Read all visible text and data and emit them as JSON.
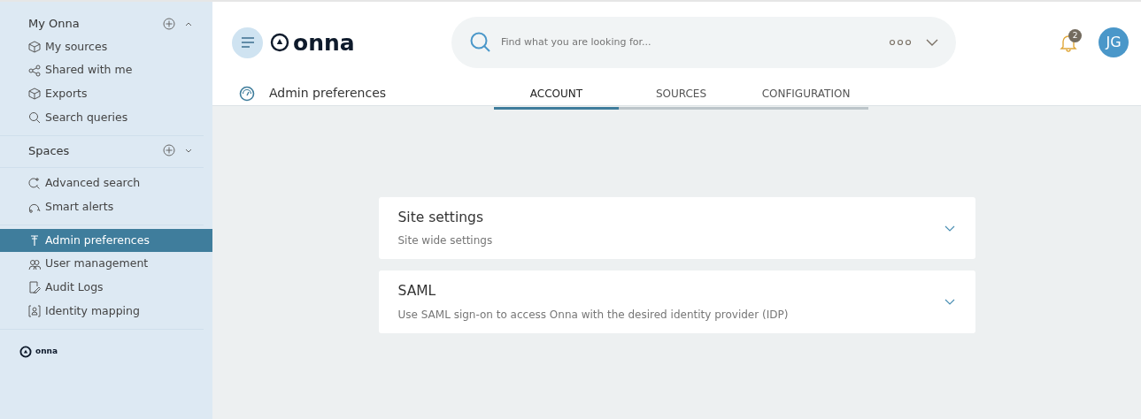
{
  "sidebar": {
    "sections": [
      {
        "title": "My Onna",
        "expanded": true,
        "items": [
          {
            "label": "My sources",
            "selected": false
          },
          {
            "label": "Shared with me",
            "selected": false
          },
          {
            "label": "Exports",
            "selected": false
          },
          {
            "label": "Search queries",
            "selected": false
          }
        ]
      },
      {
        "title": "Spaces",
        "expanded": false
      },
      {
        "items": [
          {
            "label": "Advanced search",
            "selected": false
          },
          {
            "label": "Smart alerts",
            "selected": false
          }
        ]
      },
      {
        "items": [
          {
            "label": "Admin preferences",
            "selected": true
          },
          {
            "label": "User management",
            "selected": false
          },
          {
            "label": "Audit Logs",
            "selected": false
          },
          {
            "label": "Identity mapping",
            "selected": false
          }
        ]
      }
    ],
    "footer_logo": "onna"
  },
  "header": {
    "logo": "onna",
    "search": {
      "placeholder": "Find what you are looking for..."
    },
    "notifications": "2",
    "avatar": "JG"
  },
  "page": {
    "title": "Admin preferences",
    "tabs": [
      {
        "label": "ACCOUNT",
        "selected": true
      },
      {
        "label": "SOURCES",
        "selected": false
      },
      {
        "label": "CONFIGURATION",
        "selected": false
      }
    ]
  },
  "panels": [
    {
      "title": "Site settings",
      "subtitle": "Site wide settings",
      "expanded": false
    },
    {
      "title": "SAML",
      "subtitle": "Use SAML sign-on to access Onna with the desired identity provider (IDP)",
      "expanded": false
    }
  ]
}
